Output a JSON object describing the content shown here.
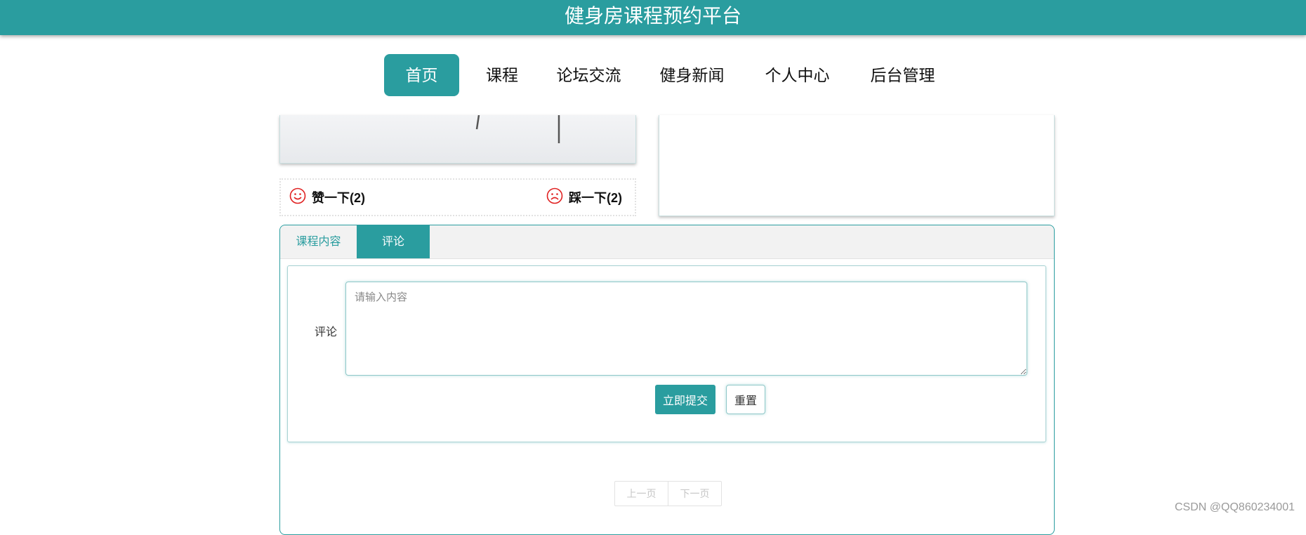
{
  "header": {
    "title": "健身房课程预约平台"
  },
  "nav": {
    "items": [
      {
        "label": "首页",
        "active": true
      },
      {
        "label": "课程"
      },
      {
        "label": "论坛交流"
      },
      {
        "label": "健身新闻"
      },
      {
        "label": "个人中心"
      },
      {
        "label": "后台管理"
      }
    ]
  },
  "votes": {
    "like_label": "赞一下(2)",
    "dislike_label": "踩一下(2)"
  },
  "tabs": {
    "items": [
      {
        "label": "课程内容"
      },
      {
        "label": "评论",
        "active": true
      }
    ]
  },
  "comment_form": {
    "label": "评论",
    "placeholder": "请输入内容",
    "value": "",
    "submit_label": "立即提交",
    "reset_label": "重置"
  },
  "pager": {
    "prev_label": "上一页",
    "next_label": "下一页"
  },
  "watermark": "CSDN @QQ860234001",
  "colors": {
    "primary": "#2a9d9f",
    "vote_icon": "#e02020"
  },
  "icons": {
    "like": "smile-icon",
    "dislike": "frown-icon"
  }
}
